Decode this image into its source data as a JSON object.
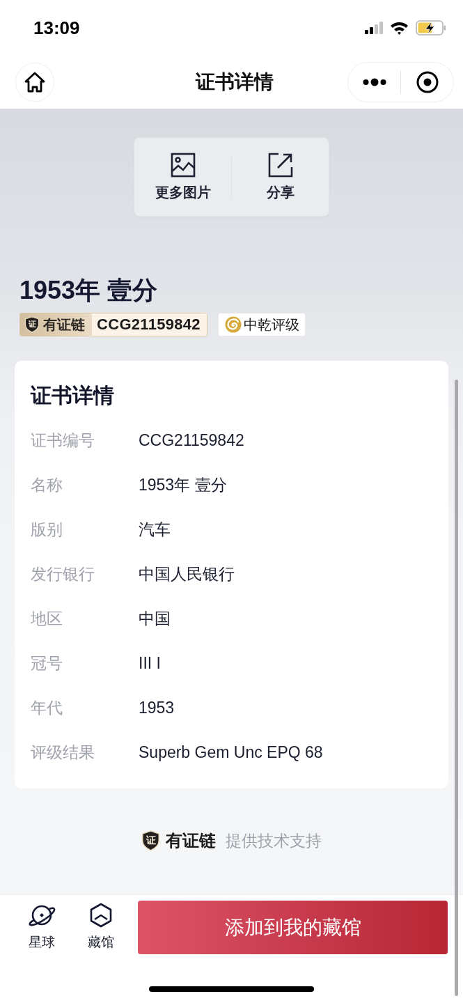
{
  "status_bar": {
    "time": "13:09"
  },
  "nav_bar": {
    "title": "证书详情"
  },
  "actions": [
    {
      "kind": "image",
      "label": "更多图片"
    },
    {
      "kind": "share",
      "label": "分享"
    }
  ],
  "item": {
    "title": "1953年 壹分",
    "chain_badge": {
      "logo_mark": "证",
      "brand": "有证链",
      "code": "CCG21159842"
    },
    "grader_badge": {
      "name": "中乾评级"
    }
  },
  "details": {
    "heading": "证书详情",
    "rows": [
      {
        "label": "证书编号",
        "value": "CCG21159842"
      },
      {
        "label": "名称",
        "value": "1953年 壹分"
      },
      {
        "label": "版别",
        "value": "汽车"
      },
      {
        "label": "发行银行",
        "value": "中国人民银行"
      },
      {
        "label": "地区",
        "value": "中国"
      },
      {
        "label": "冠号",
        "value": "III I"
      },
      {
        "label": "年代",
        "value": "1953"
      },
      {
        "label": "评级结果",
        "value": "Superb Gem Unc EPQ 68"
      }
    ]
  },
  "footer": {
    "logo_mark": "证",
    "brand": "有证链",
    "text": "提供技术支持"
  },
  "bottom_bar": {
    "tabs": [
      {
        "kind": "planet",
        "label": "星球"
      },
      {
        "kind": "hall",
        "label": "藏馆"
      }
    ],
    "primary_button": "添加到我的藏馆"
  }
}
